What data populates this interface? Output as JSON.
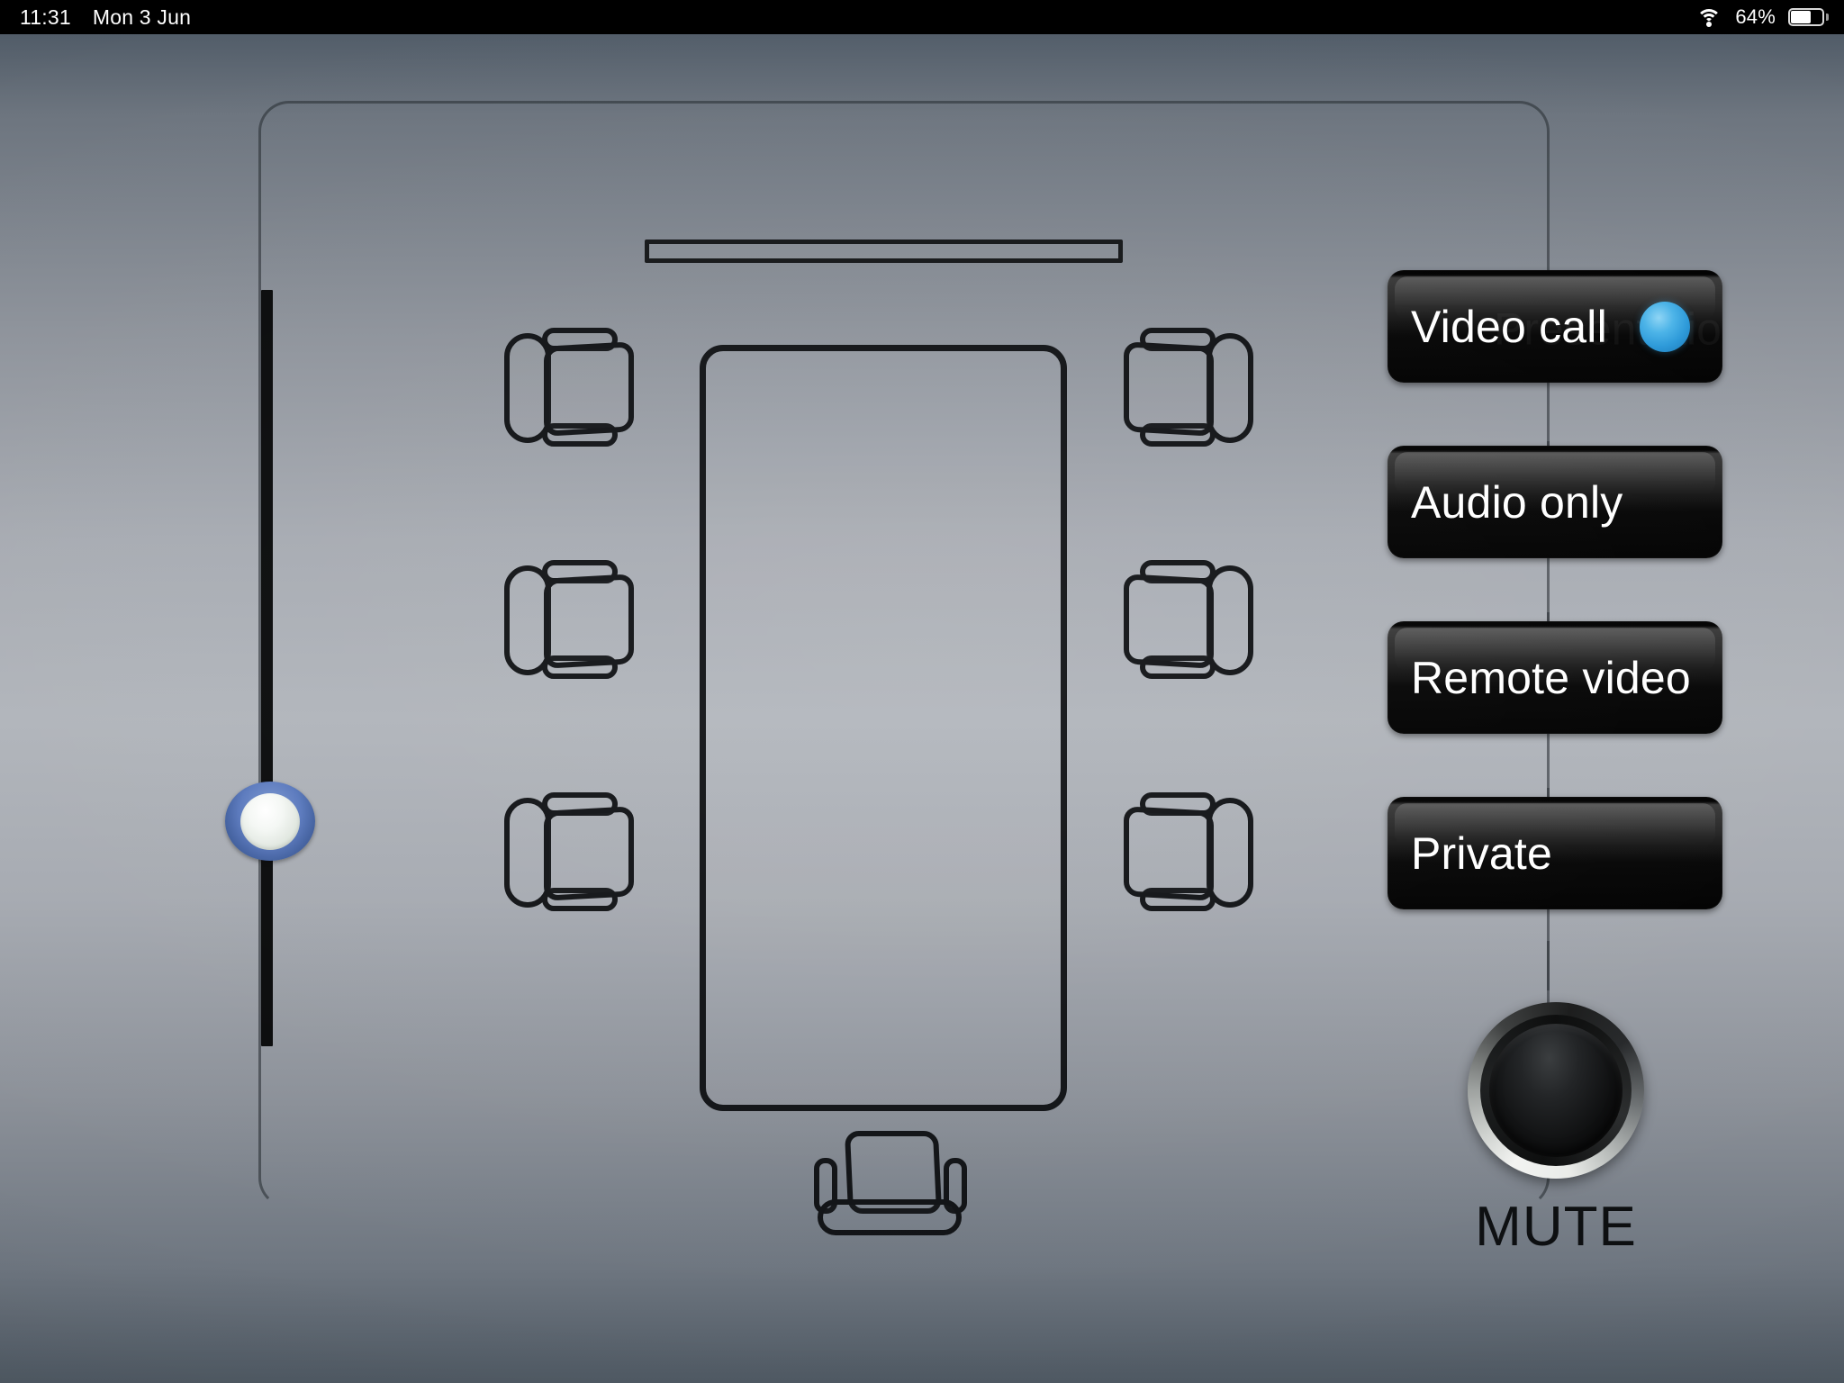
{
  "status_bar": {
    "time": "11:31",
    "date": "Mon 3 Jun",
    "battery_percent": "64%",
    "wifi_icon": "wifi-icon",
    "battery_icon": "battery-icon",
    "battery_level": 64,
    "background": "#000000",
    "text_color": "#ffffff"
  },
  "room": {
    "wall_display_name": "wall-display",
    "table_name": "conference-table",
    "chairs_left_count": 3,
    "chairs_right_count": 3,
    "chair_head_count": 1,
    "outline_color": "#2d3238",
    "furniture_stroke": "#111316"
  },
  "volume_slider": {
    "name": "volume-slider",
    "orientation": "vertical",
    "value_percent": 35,
    "track_color": "#0a0b0c",
    "thumb_ring_color": "#4a6bab",
    "thumb_cap_color": "#f0f4ef"
  },
  "mode_buttons": [
    {
      "label": "Video call",
      "ghost_label": "Presentation",
      "active": true,
      "led": true,
      "led_color": "#3aa8e0"
    },
    {
      "label": "Audio only",
      "ghost_label": "",
      "active": false,
      "led": false,
      "led_color": ""
    },
    {
      "label": "Remote video",
      "ghost_label": "",
      "active": false,
      "led": false,
      "led_color": ""
    },
    {
      "label": "Private",
      "ghost_label": "",
      "active": false,
      "led": false,
      "led_color": ""
    }
  ],
  "mute": {
    "label": "MUTE",
    "engaged": false,
    "knob_color": "#1a1b1b",
    "ring_color": "#e9ebe8",
    "label_color": "#0d0f11"
  },
  "theme": {
    "background_top": "#525d69",
    "background_mid": "#b1b5bb",
    "background_bottom": "#4f5963",
    "button_background": "#000000",
    "button_text": "#ffffff",
    "accent": "#3aa8e0"
  }
}
